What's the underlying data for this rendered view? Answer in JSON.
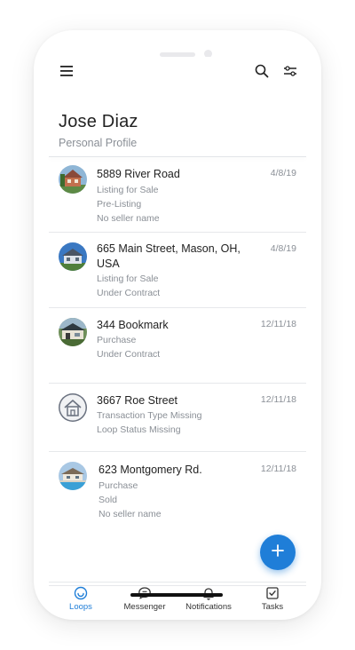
{
  "profile": {
    "name": "Jose Diaz",
    "subtitle": "Personal Profile"
  },
  "toolbar": {
    "menu_icon": "hamburger-menu-icon",
    "search_icon": "search-icon",
    "filter_icon": "filter-sliders-icon"
  },
  "loops": [
    {
      "title": "5889 River Road",
      "lines": [
        "Listing for Sale",
        "Pre-Listing",
        "No seller name"
      ],
      "date": "4/8/19",
      "thumbnail": "house-photo-brick"
    },
    {
      "title": "665 Main Street, Mason, OH, USA",
      "lines": [
        "Listing for Sale",
        "Under Contract"
      ],
      "date": "4/8/19",
      "thumbnail": "house-photo-blue-sky"
    },
    {
      "title": "344 Bookmark",
      "lines": [
        "Purchase",
        "Under Contract"
      ],
      "date": "12/11/18",
      "thumbnail": "house-photo-porch"
    },
    {
      "title": "3667 Roe Street",
      "lines": [
        "Transaction Type Missing",
        "Loop Status Missing"
      ],
      "date": "12/11/18",
      "thumbnail": "house-placeholder-icon"
    },
    {
      "title": "623 Montgomery Rd.",
      "lines": [
        "Purchase",
        "Sold",
        "No seller name"
      ],
      "date": "12/11/18",
      "thumbnail": "house-photo-pool"
    }
  ],
  "fab": {
    "icon": "plus-icon"
  },
  "nav": {
    "items": [
      {
        "label": "Loops",
        "icon": "loops-icon",
        "active": true
      },
      {
        "label": "Messenger",
        "icon": "chat-bubble-icon",
        "active": false
      },
      {
        "label": "Notifications",
        "icon": "bell-icon",
        "active": false
      },
      {
        "label": "Tasks",
        "icon": "checkbox-icon",
        "active": false
      }
    ]
  },
  "colors": {
    "accent": "#1f7ed8",
    "text_primary": "#222222",
    "text_secondary": "#8a8f96"
  }
}
